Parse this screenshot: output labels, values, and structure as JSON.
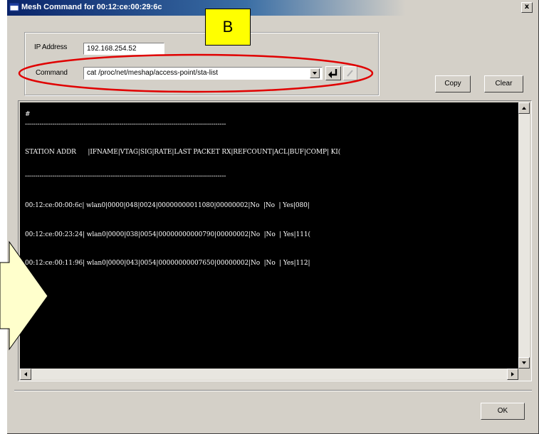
{
  "window": {
    "title": "Mesh Command for 00:12:ce:00:29:6c",
    "close_glyph": "x"
  },
  "form": {
    "ip_label": "IP Address",
    "ip_value": "192.168.254.52",
    "command_label": "Command",
    "command_value": "cat /proc/net/meshap/access-point/sta-list"
  },
  "buttons": {
    "copy": "Copy",
    "clear": "Clear",
    "ok": "OK"
  },
  "console": {
    "lines": [
      "#",
      "------------------------------------------------------------------------------------------------",
      "STATION ADDR      |IFNAME|VTAG|SIG|RATE|LAST PACKET RX|REFCOUNT|ACL|BUF|COMP| KI(",
      "------------------------------------------------------------------------------------------------",
      "00:12:ce:00:00:6c| wlan0|0000|048|0024|00000000011080|00000002|No  |No  | Yes|080|",
      "00:12:ce:00:23:24| wlan0|0000|038|0054|00000000000790|00000002|No  |No  | Yes|111(",
      "00:12:ce:00:11:96| wlan0|0000|043|0054|00000000007650|00000002|No  |No  | Yes|112|"
    ]
  },
  "annotations": {
    "marker_label": "B",
    "marker_color": "#ffff00",
    "highlight_color": "#e00000",
    "arrow_color": "#ffffcc"
  },
  "icons": {
    "app": "app-window-icon",
    "dropdown": "chevron-down-icon",
    "execute": "enter-arrow-icon",
    "edit": "edit-icon"
  }
}
